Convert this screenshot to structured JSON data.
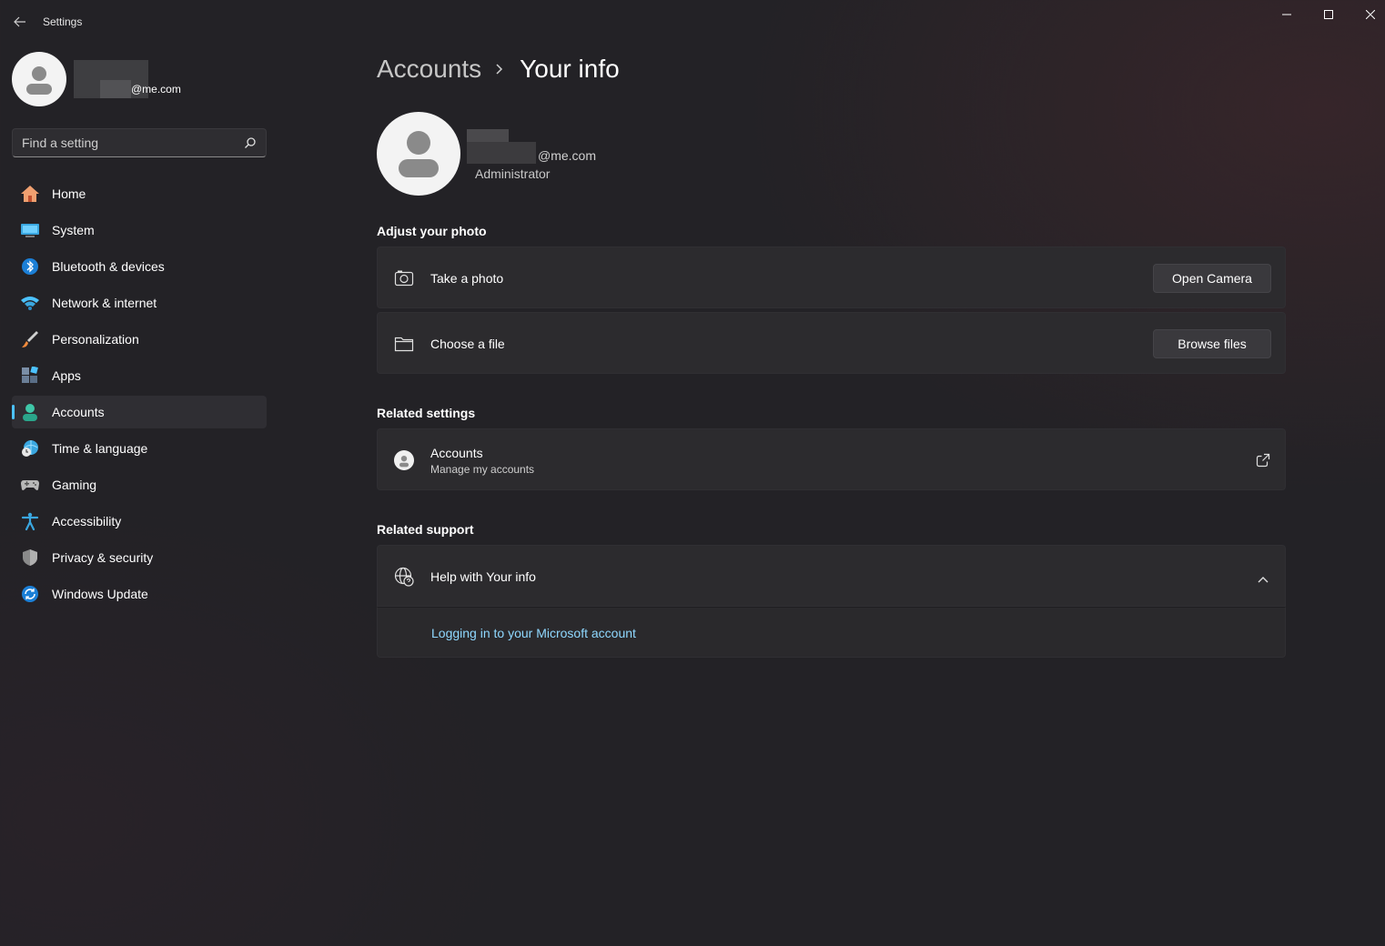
{
  "window": {
    "title": "Settings",
    "back_icon": "back-arrow-icon",
    "controls": [
      "minimize-icon",
      "maximize-icon",
      "close-icon"
    ]
  },
  "profile": {
    "email": "@me.com"
  },
  "search": {
    "placeholder": "Find a setting",
    "value": ""
  },
  "sidebar": {
    "items": [
      {
        "label": "Home",
        "icon": "home-icon"
      },
      {
        "label": "System",
        "icon": "system-icon"
      },
      {
        "label": "Bluetooth & devices",
        "icon": "bluetooth-icon"
      },
      {
        "label": "Network & internet",
        "icon": "wifi-icon"
      },
      {
        "label": "Personalization",
        "icon": "brush-icon"
      },
      {
        "label": "Apps",
        "icon": "apps-icon"
      },
      {
        "label": "Accounts",
        "icon": "accounts-icon",
        "selected": true
      },
      {
        "label": "Time & language",
        "icon": "globe-clock-icon"
      },
      {
        "label": "Gaming",
        "icon": "controller-icon"
      },
      {
        "label": "Accessibility",
        "icon": "accessibility-icon"
      },
      {
        "label": "Privacy & security",
        "icon": "shield-icon"
      },
      {
        "label": "Windows Update",
        "icon": "update-icon"
      }
    ]
  },
  "header": {
    "parent": "Accounts",
    "current": "Your info"
  },
  "user": {
    "email": "@me.com",
    "role": "Administrator"
  },
  "sections": {
    "photo_title": "Adjust your photo",
    "related_settings_title": "Related settings",
    "related_support_title": "Related support"
  },
  "photo_cards": {
    "take_photo": {
      "label": "Take a photo",
      "button": "Open Camera",
      "icon": "camera-icon"
    },
    "choose_file": {
      "label": "Choose a file",
      "button": "Browse files",
      "icon": "folder-icon"
    }
  },
  "related": {
    "accounts": {
      "title": "Accounts",
      "subtitle": "Manage my accounts",
      "icon": "account-circle-icon",
      "action_icon": "open-external-icon"
    }
  },
  "support": {
    "help_title": "Help with Your info",
    "help_icon": "web-help-icon",
    "expanded": true,
    "link": "Logging in to your Microsoft account"
  },
  "colors": {
    "accent": "#4cc2ff",
    "link": "#8fd8ff",
    "background": "#232226",
    "card": "#2c2b2e"
  }
}
